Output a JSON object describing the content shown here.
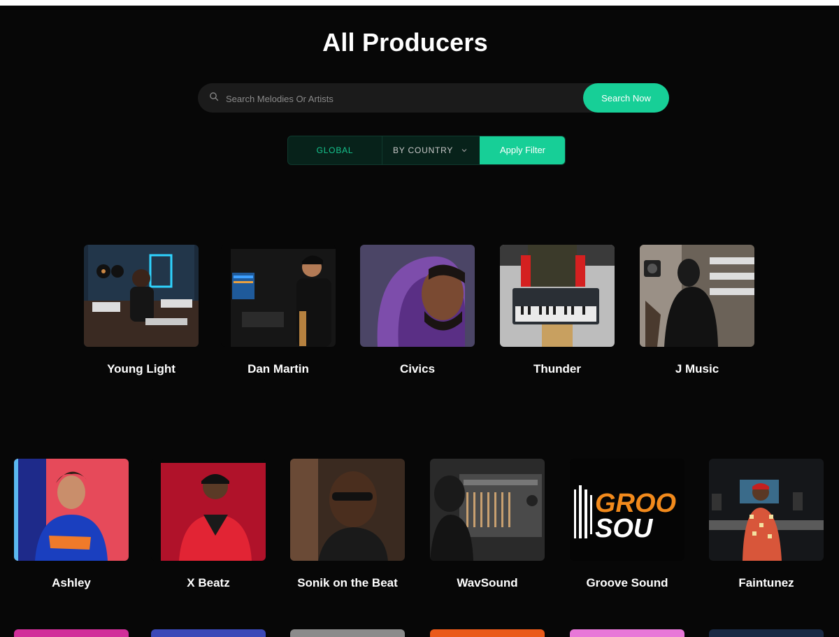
{
  "page": {
    "title": "All Producers"
  },
  "search": {
    "placeholder": "Search Melodies Or Artists",
    "value": "",
    "button_label": "Search Now"
  },
  "filters": {
    "global_label": "GLOBAL",
    "country_label": "BY COUNTRY",
    "apply_label": "Apply Filter"
  },
  "producers_row1": [
    {
      "name": "Young Light"
    },
    {
      "name": "Dan Martin"
    },
    {
      "name": "Civics"
    },
    {
      "name": "Thunder"
    },
    {
      "name": "J Music"
    }
  ],
  "producers_row2": [
    {
      "name": "Ashley"
    },
    {
      "name": "X Beatz"
    },
    {
      "name": "Sonik on the Beat"
    },
    {
      "name": "WavSound"
    },
    {
      "name": "Groove Sound",
      "logo_text": [
        "GROO",
        "SOU"
      ]
    },
    {
      "name": "Faintunez"
    }
  ],
  "colors": {
    "accent": "#17cf97",
    "background": "#070707"
  }
}
